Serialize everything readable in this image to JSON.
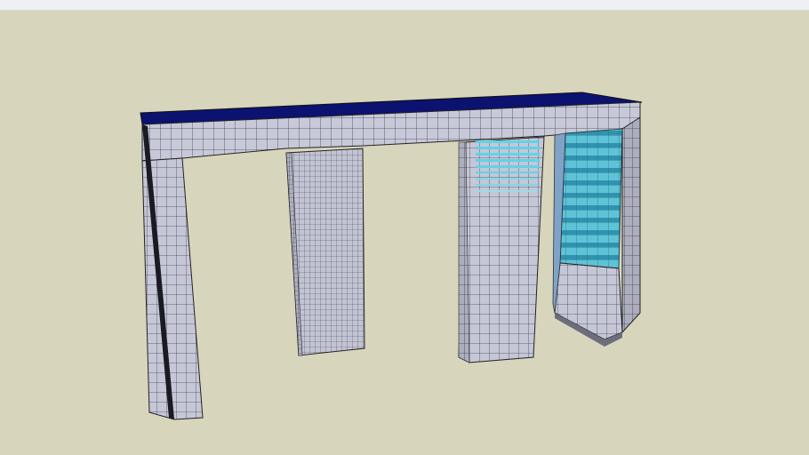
{
  "scene": {
    "description_visible_text": "",
    "colors": {
      "background": "#d8d5bd",
      "beam_top": "#0b1270",
      "panel_face": "#c4c5d5",
      "panel_side": "#a9aabb",
      "grid_line": "#3a3c4a",
      "glass": "#57c2d8",
      "glass_dark": "#2c8fae",
      "edge": "#111111"
    },
    "objects": [
      "top-beam",
      "left-leg",
      "tower-1",
      "tower-2",
      "tower-3"
    ]
  }
}
